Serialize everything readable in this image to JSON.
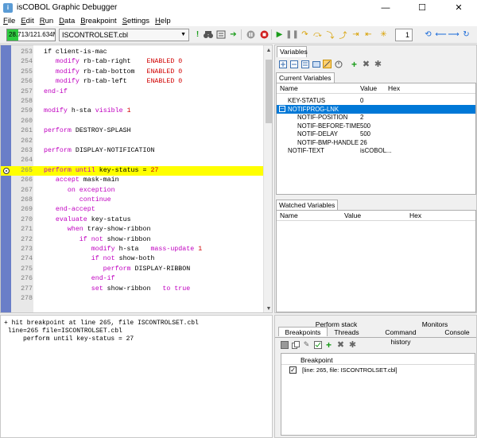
{
  "window": {
    "title": "isCOBOL Graphic Debugger",
    "minimize": "—",
    "maximize": "☐",
    "close": "✕"
  },
  "menu": [
    {
      "label": "File"
    },
    {
      "label": "Edit"
    },
    {
      "label": "Run"
    },
    {
      "label": "Data"
    },
    {
      "label": "Breakpoint"
    },
    {
      "label": "Settings"
    },
    {
      "label": "Help"
    }
  ],
  "toolbar": {
    "memory": "28.713/121.634Mb",
    "memory_fill_fraction": 0.236,
    "file": "ISCONTROLSET.cbl",
    "spinner_value": "1"
  },
  "code": [
    {
      "ln": "253",
      "parts": [
        [
          "",
          "if client-is-mac"
        ]
      ]
    },
    {
      "ln": "254",
      "parts": [
        [
          "kw",
          "   modify"
        ],
        [
          "",
          " rb-tab-right    "
        ],
        [
          "nm",
          "ENABLED 0"
        ]
      ]
    },
    {
      "ln": "255",
      "parts": [
        [
          "kw",
          "   modify"
        ],
        [
          "",
          " rb-tab-bottom   "
        ],
        [
          "nm",
          "ENABLED 0"
        ]
      ]
    },
    {
      "ln": "256",
      "parts": [
        [
          "kw",
          "   modify"
        ],
        [
          "",
          " rb-tab-left     "
        ],
        [
          "nm",
          "ENABLED 0"
        ]
      ]
    },
    {
      "ln": "257",
      "parts": [
        [
          "kw",
          "end-if"
        ]
      ]
    },
    {
      "ln": "258",
      "parts": [
        [
          "",
          ""
        ]
      ]
    },
    {
      "ln": "259",
      "parts": [
        [
          "kw",
          "modify"
        ],
        [
          "",
          " h-sta "
        ],
        [
          "kw",
          "visible"
        ],
        [
          "nm",
          " 1"
        ]
      ]
    },
    {
      "ln": "260",
      "parts": [
        [
          "",
          ""
        ]
      ]
    },
    {
      "ln": "261",
      "parts": [
        [
          "kw",
          "perform"
        ],
        [
          "",
          " DESTROY-SPLASH"
        ]
      ]
    },
    {
      "ln": "262",
      "parts": [
        [
          "",
          ""
        ]
      ]
    },
    {
      "ln": "263",
      "parts": [
        [
          "kw",
          "perform"
        ],
        [
          "",
          " DISPLAY-NOTIFICATION"
        ]
      ]
    },
    {
      "ln": "264",
      "parts": [
        [
          "",
          ""
        ]
      ]
    },
    {
      "ln": "265",
      "parts": [
        [
          "kw",
          "perform until"
        ],
        [
          "",
          " key-status = "
        ],
        [
          "nm",
          "27"
        ]
      ],
      "highlight": true,
      "breakpoint": true
    },
    {
      "ln": "266",
      "parts": [
        [
          "kw",
          "   accept"
        ],
        [
          "",
          " mask-main"
        ]
      ]
    },
    {
      "ln": "267",
      "parts": [
        [
          "kw",
          "      on exception"
        ]
      ]
    },
    {
      "ln": "268",
      "parts": [
        [
          "kw",
          "         continue"
        ]
      ]
    },
    {
      "ln": "269",
      "parts": [
        [
          "kw",
          "   end-accept"
        ]
      ]
    },
    {
      "ln": "270",
      "parts": [
        [
          "kw",
          "   evaluate"
        ],
        [
          "",
          " key-status"
        ]
      ]
    },
    {
      "ln": "271",
      "parts": [
        [
          "kw",
          "      when"
        ],
        [
          "",
          " tray-show-ribbon"
        ]
      ]
    },
    {
      "ln": "272",
      "parts": [
        [
          "kw",
          "         if not"
        ],
        [
          "",
          " show-ribbon"
        ]
      ]
    },
    {
      "ln": "273",
      "parts": [
        [
          "kw",
          "            modify"
        ],
        [
          "",
          " h-sta   "
        ],
        [
          "kw",
          "mass-update"
        ],
        [
          "nm",
          " 1"
        ]
      ]
    },
    {
      "ln": "274",
      "parts": [
        [
          "kw",
          "            if not"
        ],
        [
          "",
          " show-both"
        ]
      ]
    },
    {
      "ln": "275",
      "parts": [
        [
          "kw",
          "               perform"
        ],
        [
          "",
          " DISPLAY-RIBBON"
        ]
      ]
    },
    {
      "ln": "276",
      "parts": [
        [
          "kw",
          "            end-if"
        ]
      ]
    },
    {
      "ln": "277",
      "parts": [
        [
          "kw",
          "            set"
        ],
        [
          "",
          " show-ribbon   "
        ],
        [
          "kw",
          "to true"
        ]
      ]
    },
    {
      "ln": "278",
      "parts": [
        [
          "",
          ""
        ]
      ]
    }
  ],
  "variables_panel": {
    "tab": "Variables",
    "current_label": "Current Variables",
    "columns": [
      "Name",
      "Value",
      "Hex"
    ],
    "rows": [
      {
        "name": "KEY-STATUS",
        "value": "0",
        "indent": 0
      },
      {
        "name": "NOTIFPROG-LNK",
        "value": "",
        "indent": 0,
        "selected": true,
        "expander": "–"
      },
      {
        "name": "NOTIF-POSITION",
        "value": "2",
        "indent": 1
      },
      {
        "name": "NOTIF-BEFORE-TIME",
        "value": "500",
        "indent": 1
      },
      {
        "name": "NOTIF-DELAY",
        "value": "500",
        "indent": 1
      },
      {
        "name": "NOTIF-BMP-HANDLE",
        "value": "26",
        "indent": 1
      },
      {
        "name": "NOTIF-TEXT",
        "value": "isCOBOL...",
        "indent": 0
      }
    ],
    "watched_label": "Watched Variables",
    "watched_columns": [
      "Name",
      "Value",
      "Hex"
    ]
  },
  "console": [
    "+ hit breakpoint at line 265, file ISCONTROLSET.cbl",
    " line=265 file=ISCONTROLSET.cbl",
    "     perform until key-status = 27"
  ],
  "bottom_tabs": {
    "row1": [
      "Perform stack",
      "Monitors"
    ],
    "row2": [
      "Breakpoints",
      "Threads",
      "Command history",
      "Console"
    ],
    "active": "Breakpoints"
  },
  "breakpoints": {
    "header": "Breakpoint",
    "items": [
      {
        "checked": true,
        "text": "[line: 265, file: ISCONTROLSET.cbl]"
      }
    ]
  }
}
